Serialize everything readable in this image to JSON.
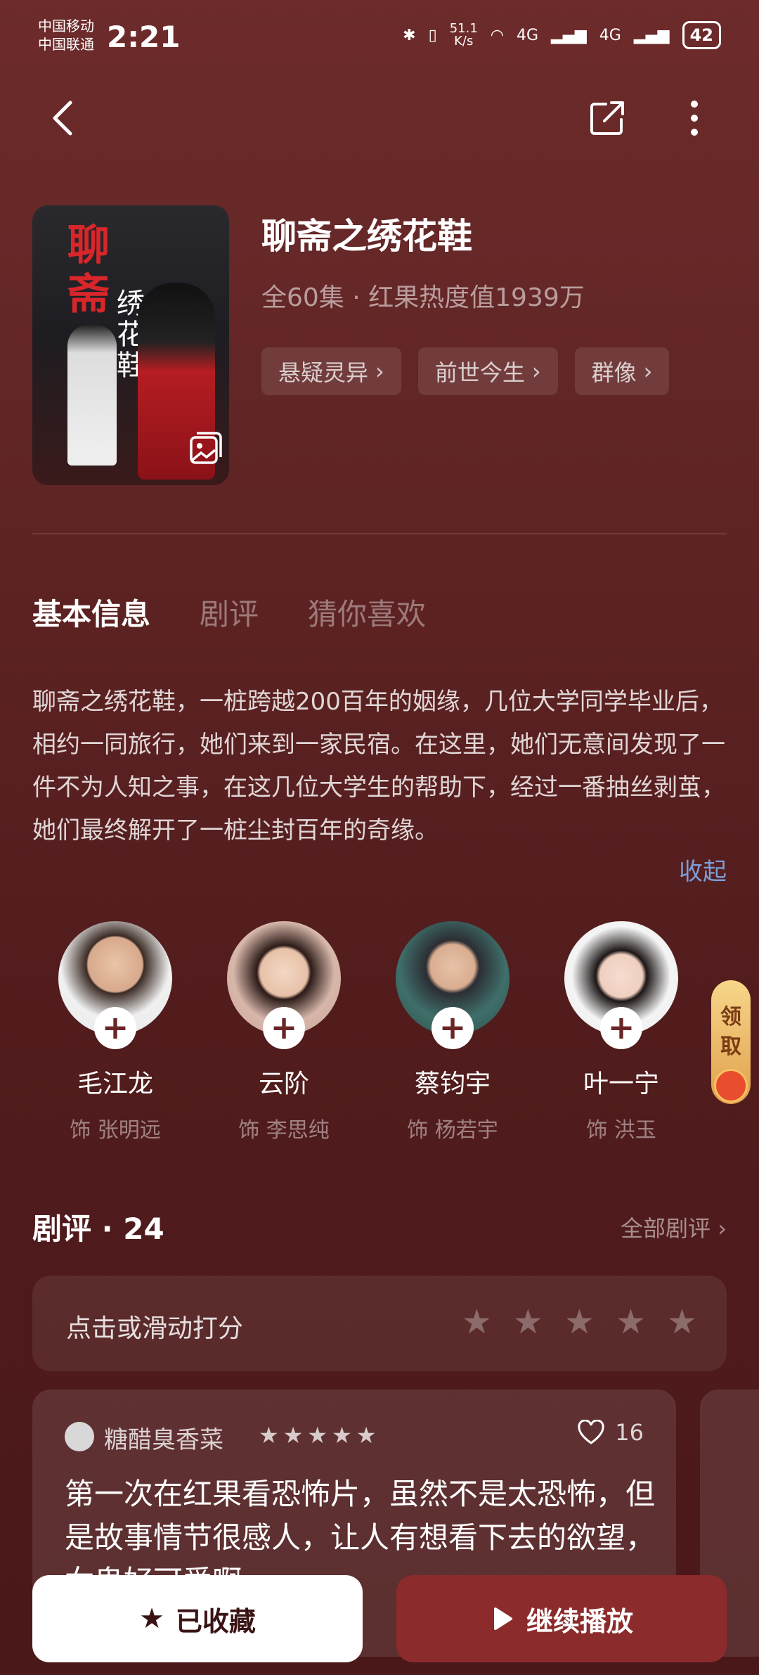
{
  "status_bar": {
    "carrier1": "中国移动",
    "carrier2": "中国联通",
    "time": "2:21",
    "net_speed_value": "51.1",
    "net_speed_unit": "K/s",
    "signal1": "4G",
    "signal2": "4G",
    "battery": "42"
  },
  "poster": {
    "title_red": "聊斋",
    "title_white": "绣花鞋"
  },
  "drama": {
    "title": "聊斋之绣花鞋",
    "episodes": "全60集",
    "heat": "红果热度值1939万",
    "tags": [
      "悬疑灵异",
      "前世今生",
      "群像"
    ]
  },
  "tabs": [
    "基本信息",
    "剧评",
    "猜你喜欢"
  ],
  "description": {
    "text": "聊斋之绣花鞋，一桩跨越200百年的姻缘，几位大学同学毕业后，相约一同旅行，她们来到一家民宿。在这里，她们无意间发现了一件不为人知之事，在这几位大学生的帮助下，经过一番抽丝剥茧，她们最终解开了一桩尘封百年的奇缘。",
    "collapse": "收起"
  },
  "cast": [
    {
      "name": "毛江龙",
      "role": "饰 张明远"
    },
    {
      "name": "云阶",
      "role": "饰 李思纯"
    },
    {
      "name": "蔡钧宇",
      "role": "饰 杨若宇"
    },
    {
      "name": "叶一宁",
      "role": "饰 洪玉"
    }
  ],
  "reward": {
    "line1": "领",
    "line2": "取"
  },
  "reviews": {
    "title": "剧评",
    "count": "24",
    "all_label": "全部剧评",
    "rate_prompt": "点击或滑动打分",
    "rating_scale": 5,
    "items": [
      {
        "user": "糖醋臭香菜",
        "stars": 5,
        "likes": "16",
        "text": "第一次在红果看恐怖片，虽然不是太恐怖，但是故事情节很感人，让人有想看下去的欲望，女鬼好可爱啊"
      }
    ]
  },
  "buttons": {
    "favorite": "已收藏",
    "continue": "继续播放"
  },
  "colors": {
    "background_top": "#6d2b2b",
    "background_bottom": "#4a1819",
    "play_button": "#8c2b2c",
    "link_blue": "#7d9ed8"
  }
}
